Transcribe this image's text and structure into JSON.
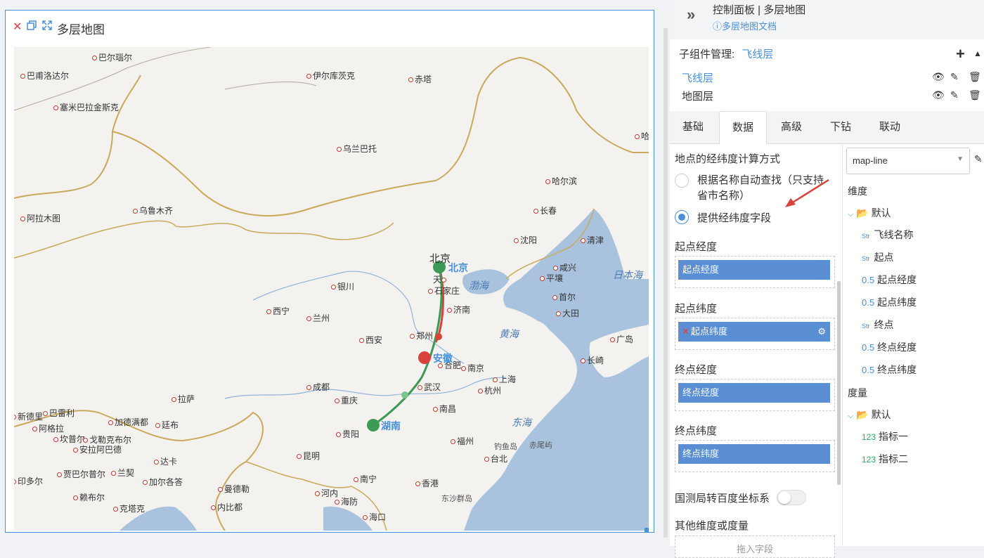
{
  "widget": {
    "title": "多层地图",
    "icons": [
      "close-icon",
      "copy-icon",
      "fullscreen-icon"
    ]
  },
  "map": {
    "cities": [
      {
        "name": "巴尔瑙尔",
        "icon": "city-dot"
      },
      {
        "name": "巴甫洛达尔",
        "icon": "city-dot"
      },
      {
        "name": "伊尔库茨克",
        "icon": "city-dot"
      },
      {
        "name": "赤塔",
        "icon": "city-dot"
      },
      {
        "name": "塞米巴拉金斯克",
        "icon": "city-dot"
      },
      {
        "name": "乌兰巴托",
        "icon": "city-dot"
      },
      {
        "name": "哈尔滨",
        "icon": "city-dot"
      },
      {
        "name": "阿拉木图",
        "icon": "city-dot"
      },
      {
        "name": "乌鲁木齐",
        "icon": "city-dot"
      },
      {
        "name": "长春",
        "icon": "city-dot"
      },
      {
        "name": "沈阳",
        "icon": "city-dot"
      },
      {
        "name": "清津",
        "icon": "city-dot"
      },
      {
        "name": "咸兴",
        "icon": "city-dot"
      },
      {
        "name": "平壤",
        "icon": "city-dot"
      },
      {
        "name": "首尔",
        "icon": "city-dot"
      },
      {
        "name": "大田",
        "icon": "city-dot"
      },
      {
        "name": "银川",
        "icon": "city-dot"
      },
      {
        "name": "西宁",
        "icon": "city-dot"
      },
      {
        "name": "兰州",
        "icon": "city-dot"
      },
      {
        "name": "石家庄",
        "icon": "city-dot"
      },
      {
        "name": "济南",
        "icon": "city-dot"
      },
      {
        "name": "郑州",
        "icon": "city-dot"
      },
      {
        "name": "西安",
        "icon": "city-dot"
      },
      {
        "name": "合肥",
        "icon": "city-dot"
      },
      {
        "name": "南京",
        "icon": "city-dot"
      },
      {
        "name": "上海",
        "icon": "city-dot"
      },
      {
        "name": "武汉",
        "icon": "city-dot"
      },
      {
        "name": "杭州",
        "icon": "city-dot"
      },
      {
        "name": "成都",
        "icon": "city-dot"
      },
      {
        "name": "重庆",
        "icon": "city-dot"
      },
      {
        "name": "拉萨",
        "icon": "city-dot"
      },
      {
        "name": "南昌",
        "icon": "city-dot"
      },
      {
        "name": "贵阳",
        "icon": "city-dot"
      },
      {
        "name": "福州",
        "icon": "city-dot"
      },
      {
        "name": "昆明",
        "icon": "city-dot"
      },
      {
        "name": "台北",
        "icon": "city-dot"
      },
      {
        "name": "南宁",
        "icon": "city-dot"
      },
      {
        "name": "香港",
        "icon": "city-dot"
      },
      {
        "name": "海口",
        "icon": "city-dot"
      },
      {
        "name": "海防",
        "icon": "city-dot"
      },
      {
        "name": "河内",
        "icon": "city-dot"
      },
      {
        "name": "曼德勒",
        "icon": "city-dot"
      },
      {
        "name": "内比都",
        "icon": "city-dot"
      },
      {
        "name": "达卡",
        "icon": "city-dot"
      },
      {
        "name": "加尔各答",
        "icon": "city-dot"
      },
      {
        "name": "兰契",
        "icon": "city-dot"
      },
      {
        "name": "贾巴尔普尔",
        "icon": "city-dot"
      },
      {
        "name": "赖布尔",
        "icon": "city-dot"
      },
      {
        "name": "克塔克",
        "icon": "city-dot"
      },
      {
        "name": "巴雷利",
        "icon": "city-dot"
      },
      {
        "name": "加德满都",
        "icon": "city-dot"
      },
      {
        "name": "廷布",
        "icon": "city-dot"
      },
      {
        "name": "阿格拉",
        "icon": "city-dot"
      },
      {
        "name": "坎普尔",
        "icon": "city-dot"
      },
      {
        "name": "戈勒克布尔",
        "icon": "city-dot"
      },
      {
        "name": "安拉阿巴德",
        "icon": "city-dot"
      },
      {
        "name": "新德里",
        "icon": "city-dot"
      },
      {
        "name": "印多尔",
        "icon": "city-dot"
      },
      {
        "name": "广岛",
        "icon": "city-dot"
      },
      {
        "name": "长崎",
        "icon": "city-dot"
      },
      {
        "name": "哈",
        "icon": "city-dot"
      }
    ],
    "tianjin_label": "天",
    "beijing_city": "北京",
    "seas": [
      "渤海",
      "黄海",
      "日本海",
      "东海"
    ],
    "islands": [
      "钓鱼岛",
      "赤尾屿",
      "东沙群岛"
    ],
    "points": {
      "beijing": "北京",
      "anhui": "安徽",
      "hunan": "湖南"
    },
    "colors": {
      "route_a": "#3d9a55",
      "route_b": "#d9413a",
      "water": "#a9c3de",
      "border": "#c9a95a"
    }
  },
  "panel": {
    "header_title": "控制面板 | 多层地图",
    "doc_link": "多层地图文档",
    "subcomp_label": "子组件管理:",
    "subcomp_active": "飞线层",
    "layers": [
      {
        "name": "飞线层",
        "active": true
      },
      {
        "name": "地图层",
        "active": false
      }
    ],
    "tabs": [
      "基础",
      "数据",
      "高级",
      "下钻",
      "联动"
    ],
    "active_tab": "数据",
    "latlng_title": "地点的经纬度计算方式",
    "radio_auto": "根据名称自动查找（只支持省市名称）",
    "radio_fields": "提供经纬度字段",
    "start_lng_label": "起点经度",
    "start_lng_chip": "起点经度",
    "start_lat_label": "起点纬度",
    "start_lat_chip": "起点纬度",
    "end_lng_label": "终点经度",
    "end_lng_chip": "终点经度",
    "end_lat_label": "终点纬度",
    "end_lat_chip": "终点纬度",
    "convert_label": "国测局转百度坐标系",
    "other_label": "其他维度或度量",
    "other_placeholder": "拖入字段",
    "dataset_select": "map-line",
    "dimension_title": "维度",
    "dimension_group": "默认",
    "dimensions": [
      {
        "type": "Str",
        "name": "飞线名称"
      },
      {
        "type": "Str",
        "name": "起点"
      },
      {
        "type": "0.5",
        "name": "起点经度"
      },
      {
        "type": "0.5",
        "name": "起点纬度"
      },
      {
        "type": "Str",
        "name": "终点"
      },
      {
        "type": "0.5",
        "name": "终点经度"
      },
      {
        "type": "0.5",
        "name": "终点纬度"
      }
    ],
    "measure_title": "度量",
    "measure_group": "默认",
    "measures": [
      {
        "type": "123",
        "name": "指标一"
      },
      {
        "type": "123",
        "name": "指标二"
      }
    ]
  }
}
